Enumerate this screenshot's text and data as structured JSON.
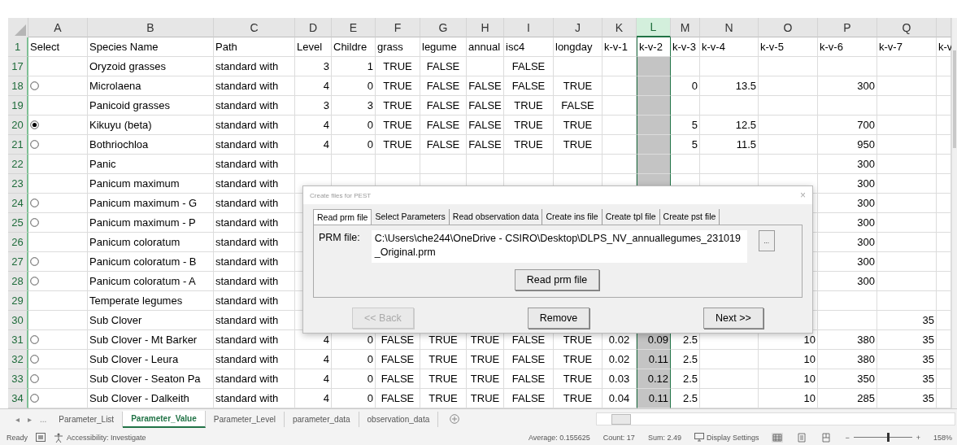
{
  "columns": [
    {
      "letter": "A",
      "selected": false
    },
    {
      "letter": "B",
      "selected": false
    },
    {
      "letter": "C",
      "selected": false
    },
    {
      "letter": "D",
      "selected": false
    },
    {
      "letter": "E",
      "selected": false
    },
    {
      "letter": "F",
      "selected": false
    },
    {
      "letter": "G",
      "selected": false
    },
    {
      "letter": "H",
      "selected": false
    },
    {
      "letter": "I",
      "selected": false
    },
    {
      "letter": "J",
      "selected": false
    },
    {
      "letter": "K",
      "selected": false
    },
    {
      "letter": "L",
      "selected": true
    },
    {
      "letter": "M",
      "selected": false
    },
    {
      "letter": "N",
      "selected": false
    },
    {
      "letter": "O",
      "selected": false
    },
    {
      "letter": "P",
      "selected": false
    },
    {
      "letter": "Q",
      "selected": false
    },
    {}
  ],
  "rows": [
    {
      "num": "1",
      "cells": [
        "Select",
        "Species Name",
        "Path",
        "Level",
        "Childre",
        "grass",
        "legume",
        "annual",
        "isc4",
        "longday",
        "k-v-1",
        "k-v-2",
        "k-v-3",
        "k-v-4",
        "k-v-5",
        "k-v-6",
        "k-v-7",
        "k-v"
      ]
    },
    {
      "num": "17",
      "cells": [
        null,
        "Oryzoid grasses",
        "standard with",
        "3",
        "1",
        "TRUE",
        "FALSE",
        null,
        "FALSE",
        null,
        null,
        null,
        null,
        null,
        null,
        null,
        null,
        null
      ]
    },
    {
      "num": "18",
      "radio": {
        "selected": false
      },
      "cells": [
        null,
        "Microlaena",
        "standard with",
        "4",
        "0",
        "TRUE",
        "FALSE",
        "FALSE",
        "FALSE",
        "TRUE",
        null,
        null,
        "0",
        "13.5",
        null,
        "300",
        null,
        null
      ]
    },
    {
      "num": "19",
      "cells": [
        null,
        "Panicoid grasses",
        "standard with",
        "3",
        "3",
        "TRUE",
        "FALSE",
        "FALSE",
        "TRUE",
        "FALSE",
        null,
        null,
        null,
        null,
        null,
        null,
        null,
        null
      ]
    },
    {
      "num": "20",
      "radio": {
        "selected": true
      },
      "cells": [
        null,
        "Kikuyu (beta)",
        "standard with",
        "4",
        "0",
        "TRUE",
        "FALSE",
        "FALSE",
        "TRUE",
        "TRUE",
        null,
        null,
        "5",
        "12.5",
        null,
        "700",
        null,
        null
      ]
    },
    {
      "num": "21",
      "radio": {
        "selected": false
      },
      "cells": [
        null,
        "Bothriochloa",
        "standard with",
        "4",
        "0",
        "TRUE",
        "FALSE",
        "FALSE",
        "TRUE",
        "TRUE",
        null,
        null,
        "5",
        "11.5",
        null,
        "950",
        null,
        null
      ]
    },
    {
      "num": "22",
      "cells": [
        null,
        "Panic",
        "standard with",
        null,
        null,
        null,
        null,
        null,
        null,
        null,
        null,
        null,
        null,
        null,
        null,
        "300",
        null,
        null
      ]
    },
    {
      "num": "23",
      "cells": [
        null,
        "Panicum maximum",
        "standard with",
        null,
        null,
        null,
        null,
        null,
        null,
        null,
        null,
        null,
        null,
        null,
        null,
        "300",
        null,
        null
      ]
    },
    {
      "num": "24",
      "radio": {
        "selected": false
      },
      "cells": [
        null,
        "Panicum maximum - G",
        "standard with",
        null,
        null,
        null,
        null,
        null,
        null,
        null,
        null,
        null,
        null,
        null,
        null,
        "300",
        null,
        null
      ]
    },
    {
      "num": "25",
      "radio": {
        "selected": false
      },
      "cells": [
        null,
        "Panicum maximum - P",
        "standard with",
        null,
        null,
        null,
        null,
        null,
        null,
        null,
        null,
        null,
        null,
        null,
        null,
        "300",
        null,
        null
      ]
    },
    {
      "num": "26",
      "cells": [
        null,
        "Panicum coloratum",
        "standard with",
        null,
        null,
        null,
        null,
        null,
        null,
        null,
        null,
        null,
        null,
        null,
        null,
        "300",
        null,
        null
      ]
    },
    {
      "num": "27",
      "radio": {
        "selected": false
      },
      "cells": [
        null,
        "Panicum coloratum - B",
        "standard with",
        null,
        null,
        null,
        null,
        null,
        null,
        null,
        null,
        null,
        null,
        null,
        null,
        "300",
        null,
        null
      ]
    },
    {
      "num": "28",
      "radio": {
        "selected": false
      },
      "cells": [
        null,
        "Panicum coloratum - A",
        "standard with",
        null,
        null,
        null,
        null,
        null,
        null,
        null,
        null,
        null,
        null,
        null,
        null,
        "300",
        null,
        null
      ]
    },
    {
      "num": "29",
      "cells": [
        null,
        "Temperate legumes",
        "standard with",
        null,
        null,
        null,
        null,
        null,
        null,
        null,
        null,
        null,
        null,
        null,
        null,
        null,
        null,
        null
      ]
    },
    {
      "num": "30",
      "cells": [
        null,
        "Sub Clover",
        "standard with",
        null,
        null,
        null,
        null,
        null,
        null,
        null,
        null,
        null,
        null,
        null,
        null,
        null,
        "35",
        null
      ]
    },
    {
      "num": "31",
      "radio": {
        "selected": false
      },
      "cells": [
        null,
        "Sub Clover - Mt Barker",
        "standard with",
        "4",
        "0",
        "FALSE",
        "TRUE",
        "TRUE",
        "FALSE",
        "TRUE",
        "0.02",
        "0.09",
        "2.5",
        null,
        "10",
        "380",
        "35",
        null
      ]
    },
    {
      "num": "32",
      "radio": {
        "selected": false
      },
      "cells": [
        null,
        "Sub Clover - Leura",
        "standard with",
        "4",
        "0",
        "FALSE",
        "TRUE",
        "TRUE",
        "FALSE",
        "TRUE",
        "0.02",
        "0.11",
        "2.5",
        null,
        "10",
        "380",
        "35",
        null
      ]
    },
    {
      "num": "33",
      "radio": {
        "selected": false
      },
      "cells": [
        null,
        "Sub Clover - Seaton Pa",
        "standard with",
        "4",
        "0",
        "FALSE",
        "TRUE",
        "TRUE",
        "FALSE",
        "TRUE",
        "0.03",
        "0.12",
        "2.5",
        null,
        "10",
        "350",
        "35",
        null
      ]
    },
    {
      "num": "34",
      "radio": {
        "selected": false
      },
      "cells": [
        null,
        "Sub Clover - Dalkeith",
        "standard with",
        "4",
        "0",
        "FALSE",
        "TRUE",
        "TRUE",
        "FALSE",
        "TRUE",
        "0.04",
        "0.11",
        "2.5",
        null,
        "10",
        "285",
        "35",
        null
      ]
    }
  ],
  "dialog": {
    "title": "Create files for PEST",
    "close": "×",
    "tabs": [
      {
        "label": "Read prm file",
        "selected": true
      },
      {
        "label": "Select Parameters",
        "selected": false
      },
      {
        "label": "Read observation data",
        "selected": false
      },
      {
        "label": "Create ins file",
        "selected": false
      },
      {
        "label": "Create tpl file",
        "selected": false
      },
      {
        "label": "Create pst file",
        "selected": false
      }
    ],
    "prm_label": "PRM file:",
    "prm_path": "C:\\Users\\che244\\OneDrive - CSIRO\\Desktop\\DLPS_NV_annuallegumes_231019_Original.prm",
    "browse": "...",
    "read_button": "Read prm file",
    "buttons": [
      {
        "label": "<< Back",
        "disabled": true
      },
      {
        "label": "Remove",
        "disabled": false
      },
      {
        "label": "Next >>",
        "disabled": false
      }
    ]
  },
  "sheet_nav": [
    "◂",
    "▸",
    "..."
  ],
  "sheet_tabs": [
    {
      "label": "Parameter_List",
      "selected": false
    },
    {
      "label": "Parameter_Value",
      "selected": true
    },
    {
      "label": "Parameter_Level",
      "selected": false
    },
    {
      "label": "parameter_data",
      "selected": false
    },
    {
      "label": "observation_data",
      "selected": false
    }
  ],
  "status_bar": {
    "ready": "Ready",
    "accessibility": "Accessibility: Investigate",
    "average": "Average: 0.155625",
    "count": "Count: 17",
    "sum": "Sum: 2.49",
    "display_settings": "Display Settings",
    "zoom_out": "−",
    "zoom_in": "+",
    "zoom": {
      "level": 0.6
    },
    "zoom_value": "158%"
  }
}
